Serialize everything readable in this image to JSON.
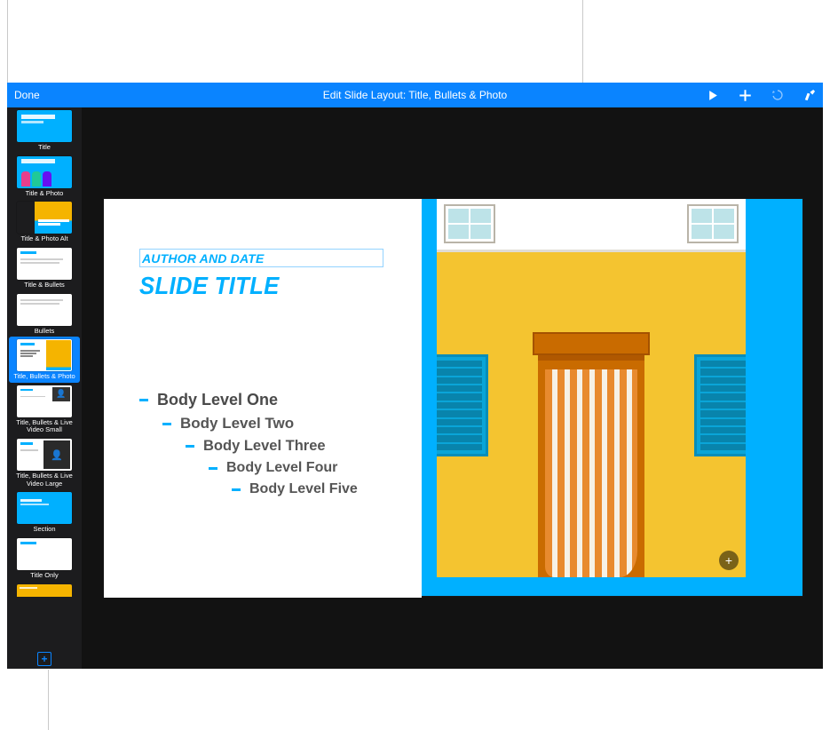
{
  "toolbar": {
    "done_label": "Done",
    "title_prefix": "Edit Slide Layout: ",
    "title_layout": "Title, Bullets & Photo",
    "icons": {
      "play": "play-icon",
      "add": "plus-icon",
      "undo": "undo-icon",
      "format": "format-brush-icon"
    }
  },
  "sidebar": {
    "layouts": [
      {
        "id": "title",
        "label": "Title"
      },
      {
        "id": "title-photo",
        "label": "Title & Photo"
      },
      {
        "id": "title-photo-alt",
        "label": "Title & Photo Alt"
      },
      {
        "id": "title-bullets",
        "label": "Title & Bullets"
      },
      {
        "id": "bullets",
        "label": "Bullets"
      },
      {
        "id": "title-bullets-photo",
        "label": "Title, Bullets & Photo",
        "selected": true
      },
      {
        "id": "title-bullets-live-small",
        "label": "Title, Bullets & Live Video Small"
      },
      {
        "id": "title-bullets-live-large",
        "label": "Title, Bullets & Live Video Large"
      },
      {
        "id": "section",
        "label": "Section"
      },
      {
        "id": "title-only",
        "label": "Title Only"
      }
    ],
    "add_label": "+"
  },
  "slide": {
    "meta": "AUTHOR AND DATE",
    "title": "SLIDE TITLE",
    "body": [
      "Body Level One",
      "Body Level Two",
      "Body Level Three",
      "Body Level Four",
      "Body Level Five"
    ],
    "add_media_label": "+"
  }
}
